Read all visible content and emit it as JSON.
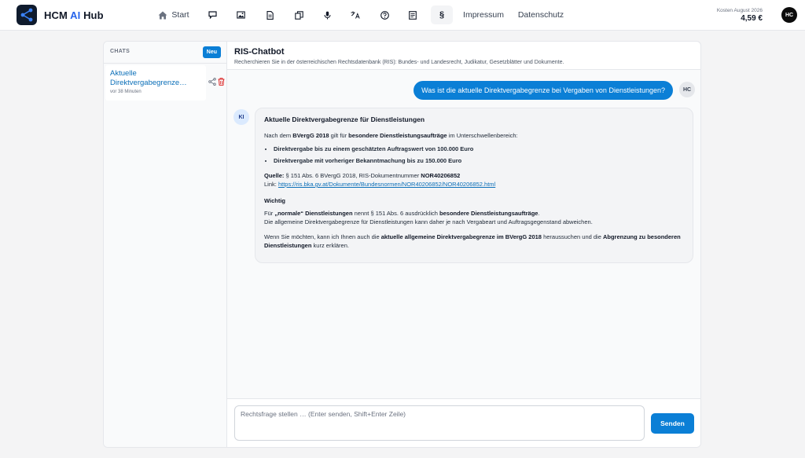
{
  "brand": {
    "prefix": "HCM",
    "ai": "AI",
    "suffix": "Hub"
  },
  "nav": {
    "start_label": "Start",
    "icons": [
      "chat-icon",
      "image-icon",
      "document-icon",
      "copy-icon",
      "microphone-icon",
      "translate-icon",
      "help-icon",
      "notes-icon",
      "paragraph-icon"
    ],
    "paragraph_label": "§",
    "impressum": "Impressum",
    "datenschutz": "Datenschutz"
  },
  "cost": {
    "label": "Kosten August 2026",
    "value": "4,59 €"
  },
  "user": {
    "initials": "HC"
  },
  "sidebar": {
    "title": "CHATS",
    "new_label": "Neu",
    "items": [
      {
        "title": "Aktuelle Direktvergabegrenze…",
        "time": "vor 38 Minuten"
      }
    ]
  },
  "chat": {
    "title": "RIS-Chatbot",
    "subtitle": "Recherchieren Sie in der österreichischen Rechtsdatenbank (RIS): Bundes- und Landesrecht, Judikatur, Gesetzblätter und Dokumente.",
    "user_message": "Was ist die aktuelle Direktvergabegrenze bei Vergaben von Dienstleistungen?",
    "ki_label": "KI",
    "answer": {
      "heading": "Aktuelle Direktvergabegrenze für Dienstleistungen",
      "intro_1": "Nach dem ",
      "intro_b1": "BVergG 2018",
      "intro_2": " gilt für ",
      "intro_b2": "besondere Dienstleistungsaufträge",
      "intro_3": " im Unterschwellenbereich:",
      "bullets": [
        "Direktvergabe bis zu einem geschätzten Auftragswert von 100.000 Euro",
        "Direktvergabe mit vorheriger Bekanntmachung bis zu 150.000 Euro"
      ],
      "source_label": "Quelle:",
      "source_text": " § 151 Abs. 6 BVergG 2018, RIS-Dokumentnummer ",
      "source_doc": "NOR40206852",
      "link_label": "Link: ",
      "link_url": "https://ris.bka.gv.at/Dokumente/Bundesnormen/NOR40206852/NOR40206852.html",
      "wichtig": "Wichtig",
      "w1_a": "Für ",
      "w1_b": "„normale“ Dienstleistungen",
      "w1_c": " nennt § 151 Abs. 6 ausdrücklich ",
      "w1_d": "besondere Dienstleistungsaufträge",
      "w1_e": ".",
      "w2": "Die allgemeine Direktvergabegrenze für Dienstleistungen kann daher je nach Vergabeart und Auftragsgegenstand abweichen.",
      "o_a": "Wenn Sie möchten, kann ich Ihnen auch die ",
      "o_b": "aktuelle allgemeine Direktvergabegrenze im BVergG 2018",
      "o_c": " heraussuchen und die ",
      "o_d": "Abgrenzung zu besonderen Dienstleistungen",
      "o_e": " kurz erklären."
    }
  },
  "composer": {
    "placeholder": "Rechtsfrage stellen … (Enter senden, Shift+Enter Zeile)",
    "send_label": "Senden"
  },
  "colors": {
    "accent": "#0b7fd6",
    "link": "#0b6fb8",
    "logo_bg": "#0f1b2d",
    "delete": "#dc2626"
  }
}
